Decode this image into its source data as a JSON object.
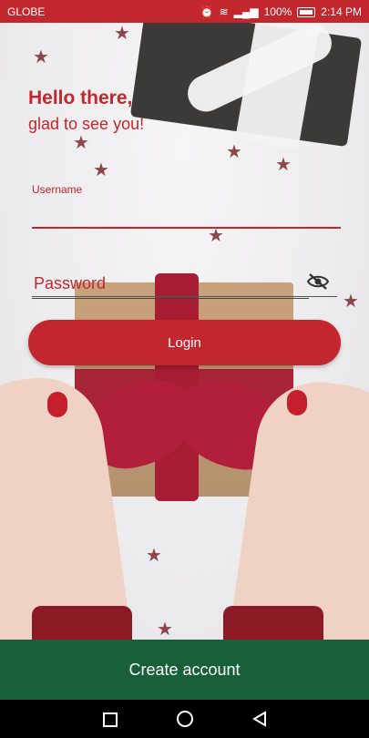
{
  "status_bar": {
    "carrier": "GLOBE",
    "battery": "100%",
    "time": "2:14 PM"
  },
  "greeting": {
    "title": "Hello there,",
    "subtitle": "glad to see you!"
  },
  "form": {
    "username_label": "Username",
    "username_value": "",
    "password_placeholder": "Password",
    "password_value": "",
    "login_label": "Login"
  },
  "footer": {
    "create_account_label": "Create account"
  },
  "icons": {
    "password_visibility": "eye-off-icon",
    "nav_recents": "square-icon",
    "nav_home": "circle-icon",
    "nav_back": "triangle-back-icon"
  },
  "colors": {
    "accent": "#c2272d",
    "footer": "#17603a"
  }
}
